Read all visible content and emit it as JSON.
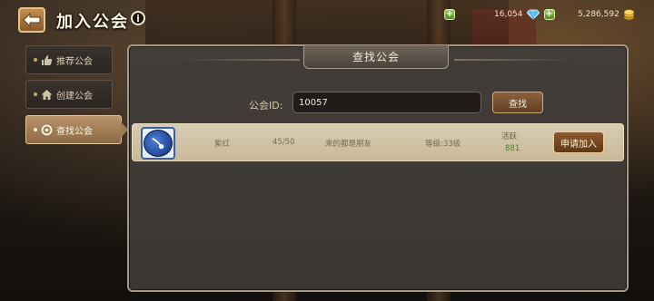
{
  "header": {
    "title": "加入公会",
    "info_icon_glyph": "i"
  },
  "resources": {
    "diamonds": "16,054",
    "gold": "5,286,592"
  },
  "sidebar": {
    "items": [
      {
        "label": "推荐公会",
        "icon": "thumbs-up-icon"
      },
      {
        "label": "创建公会",
        "icon": "house-icon"
      },
      {
        "label": "查找公会",
        "icon": "magnifier-icon"
      }
    ],
    "active_index": 2
  },
  "panel": {
    "title": "查找公会",
    "search": {
      "label": "公会ID:",
      "value": "10057",
      "button_label": "查找"
    },
    "result": {
      "leader": "紫红",
      "members": "45/50",
      "name": "来的都是朋友",
      "level": "等级:33级",
      "activity_label": "活跃",
      "activity_value": "881",
      "apply_label": "申请加入"
    }
  },
  "colors": {
    "accent_gold": "#c48f55",
    "panel_bg": "#3e3934",
    "active_tab": "#b9936a",
    "activity_green": "#4f7f2c"
  }
}
